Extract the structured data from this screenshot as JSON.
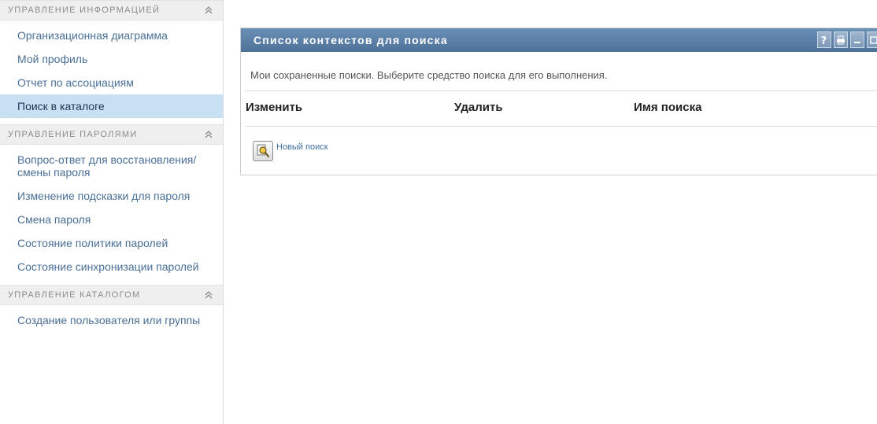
{
  "sidebar": {
    "sections": [
      {
        "title": "УПРАВЛЕНИЕ ИНФОРМАЦИЕЙ",
        "items": [
          {
            "label": "Организационная диаграмма"
          },
          {
            "label": "Мой профиль"
          },
          {
            "label": "Отчет по ассоциациям"
          },
          {
            "label": "Поиск в каталоге",
            "active": true
          }
        ]
      },
      {
        "title": "УПРАВЛЕНИЕ ПАРОЛЯМИ",
        "items": [
          {
            "label": "Вопрос-ответ для восстановления/смены пароля"
          },
          {
            "label": "Изменение подсказки для пароля"
          },
          {
            "label": "Смена пароля"
          },
          {
            "label": "Состояние политики паролей"
          },
          {
            "label": "Состояние синхронизации паролей"
          }
        ]
      },
      {
        "title": "УПРАВЛЕНИЕ КАТАЛОГОМ",
        "items": [
          {
            "label": "Создание пользователя или группы"
          }
        ]
      }
    ]
  },
  "portlet": {
    "title": "Список контекстов для поиска",
    "description": "Мои сохраненные поиски. Выберите средство поиска для его выполнения.",
    "columns": {
      "edit": "Изменить",
      "delete": "Удалить",
      "name": "Имя поиска"
    },
    "new_search_label": "Новый поиск",
    "titlebar_icons": [
      "help-icon",
      "print-icon",
      "minimize-icon",
      "maximize-icon"
    ]
  },
  "colors": {
    "titlebar": "#5b7fa6",
    "active_item_bg": "#c9dff2",
    "link": "#4a6f95",
    "section_bg": "#efefef"
  }
}
